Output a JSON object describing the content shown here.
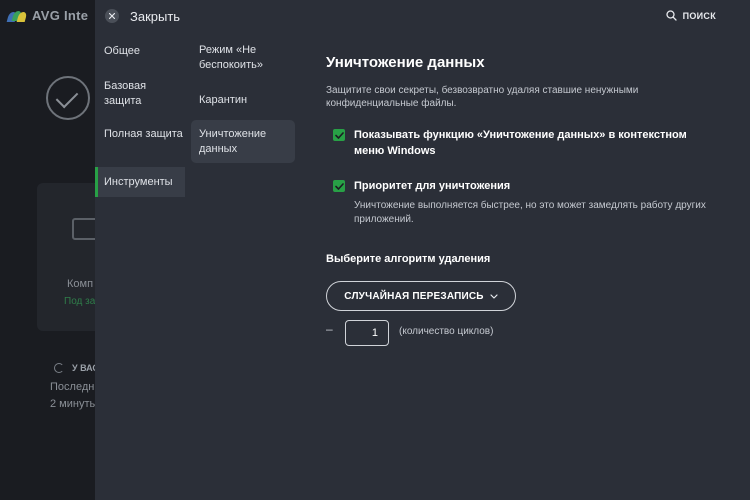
{
  "background_app": {
    "title": "AVG Inte",
    "card_title": "Комп",
    "card_sub": "Под за",
    "status": "У ВАС",
    "last_update": "Последн",
    "minutes": "2 минуты"
  },
  "topbar": {
    "close_label": "Закрыть",
    "search_label": "ПОИСК"
  },
  "nav_primary": [
    {
      "label": "Общее",
      "active": false
    },
    {
      "label": "Базовая защита",
      "active": false
    },
    {
      "label": "Полная защита",
      "active": false
    },
    {
      "label": "Инструменты",
      "active": true
    }
  ],
  "nav_secondary": [
    {
      "label": "Режим «Не беспокоить»",
      "active": false
    },
    {
      "label": "Карантин",
      "active": false
    },
    {
      "label": "Уничтожение данных",
      "active": true
    }
  ],
  "content": {
    "title": "Уничтожение данных",
    "description": "Защитите свои секреты, безвозвратно удаляя ставшие ненужными конфиденциальные файлы.",
    "checkboxes": [
      {
        "label": "Показывать функцию «Уничтожение данных» в контекстном меню Windows",
        "checked": true
      },
      {
        "label": "Приоритет для уничтожения",
        "checked": true
      }
    ],
    "priority_note": "Уничтожение выполняется быстрее, но это может замедлять работу других приложений.",
    "algorithm_label": "Выберите алгоритм удаления",
    "algorithm_selected": "СЛУЧАЙНАЯ ПЕРЕЗАПИСЬ",
    "minus_symbol": "–",
    "cycles_value": "1",
    "cycles_label": "(количество циклов)"
  },
  "colors": {
    "accent_green": "#28a046",
    "panel_bg": "#2b2f38",
    "active_item_bg": "#383d47",
    "backdrop": "#1a1c21"
  }
}
